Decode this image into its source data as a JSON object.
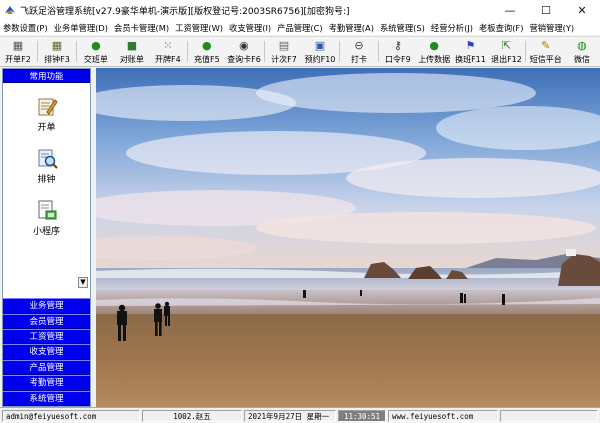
{
  "window": {
    "title": "飞跃足浴管理系统[v27.9豪华单机-演示版][版权登记号:2003SR6756][加密狗号:]",
    "controls": {
      "minimize": "—",
      "maximize": "☐",
      "close": "✕"
    }
  },
  "menu": [
    "参数设置(P)",
    "业务单管理(D)",
    "会员卡管理(M)",
    "工资管理(W)",
    "收支管理(I)",
    "产品管理(C)",
    "考勤管理(A)",
    "系统管理(S)",
    "经营分析(J)",
    "老板查询(F)",
    "营销管理(Y)"
  ],
  "toolbar": [
    {
      "label": "开单F2",
      "icon": "new-order-icon",
      "glyph": "▦",
      "color": "#555555"
    },
    {
      "label": "排钟F3",
      "icon": "clock-schedule-icon",
      "glyph": "▦",
      "color": "#556b2f"
    },
    {
      "label": "交班单",
      "icon": "money-bag-icon",
      "glyph": "●",
      "color": "#1e8c1e"
    },
    {
      "label": "对账单",
      "icon": "ledger-icon",
      "glyph": "■",
      "color": "#2e7d32"
    },
    {
      "label": "开牌F4",
      "icon": "tokens-icon",
      "glyph": "⁙",
      "color": "#3a3a7a"
    },
    {
      "label": "充值F5",
      "icon": "recharge-icon",
      "glyph": "●",
      "color": "#1e8c1e"
    },
    {
      "label": "查询卡F6",
      "icon": "binoculars-icon",
      "glyph": "◉",
      "color": "#333333"
    },
    {
      "label": "计次F7",
      "icon": "count-icon",
      "glyph": "▤",
      "color": "#666666"
    },
    {
      "label": "预约F10",
      "icon": "reservation-icon",
      "glyph": "▣",
      "color": "#3355aa"
    },
    {
      "label": "打卡",
      "icon": "punch-clock-icon",
      "glyph": "⊖",
      "color": "#444444"
    },
    {
      "label": "口令F9",
      "icon": "key-icon",
      "glyph": "⚷",
      "color": "#333333"
    },
    {
      "label": "上传数据",
      "icon": "upload-icon",
      "glyph": "●",
      "color": "#1e8c1e"
    },
    {
      "label": "换班F11",
      "icon": "shift-change-icon",
      "glyph": "⚑",
      "color": "#2244cc"
    },
    {
      "label": "退出F12",
      "icon": "exit-icon",
      "glyph": "⇱",
      "color": "#2e7d32"
    },
    {
      "label": "短信平台",
      "icon": "sms-icon",
      "glyph": "✎",
      "color": "#aa7700"
    },
    {
      "label": "微信",
      "icon": "wechat-icon",
      "glyph": "◍",
      "color": "#1e8c1e"
    }
  ],
  "sidebar": {
    "header": "常用功能",
    "functions": [
      {
        "label": "开单",
        "icon": "pencil-note-icon"
      },
      {
        "label": "排钟",
        "icon": "magnifier-doc-icon"
      },
      {
        "label": "小程序",
        "icon": "mini-program-icon"
      }
    ],
    "scroll_arrow": "▼",
    "nav": [
      "业务管理",
      "会员管理",
      "工资管理",
      "收支管理",
      "产品管理",
      "考勤管理",
      "系统管理"
    ]
  },
  "status": {
    "email": "admin@feiyuesoft.com",
    "user": "1002.赵五",
    "date": "2021年9月27日 星期一",
    "time": "11:30:51",
    "website": "www.feiyuesoft.com"
  }
}
